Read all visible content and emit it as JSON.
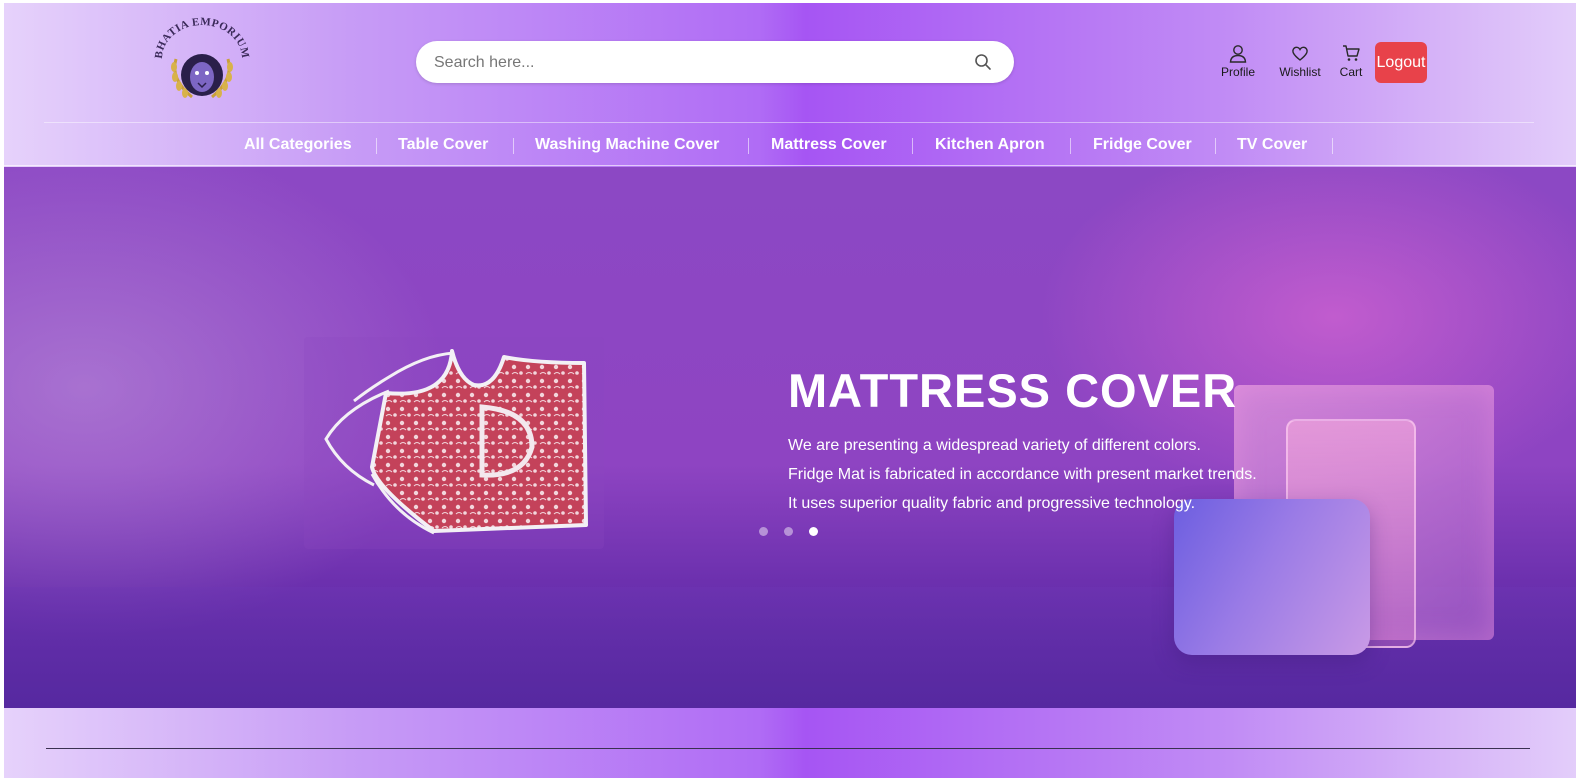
{
  "brand": {
    "logo_text": "BHATIA EMPORIUM"
  },
  "search": {
    "placeholder": "Search here...",
    "icon": "search-icon"
  },
  "user_links": [
    {
      "label": "Profile",
      "icon": "user-icon"
    },
    {
      "label": "Wishlist",
      "icon": "heart-icon"
    },
    {
      "label": "Cart",
      "icon": "cart-icon"
    }
  ],
  "logout_label": "Logout",
  "nav": {
    "items": [
      {
        "label": "All Categories"
      },
      {
        "label": "Table Cover"
      },
      {
        "label": "Washing Machine Cover"
      },
      {
        "label": "Mattress Cover"
      },
      {
        "label": "Kitchen Apron"
      },
      {
        "label": "Fridge Cover"
      },
      {
        "label": "TV Cover"
      }
    ]
  },
  "hero": {
    "title": "MATTRESS COVER",
    "lines": [
      "We are presenting a widespread variety of different colors.",
      "Fridge Mat is fabricated in accordance with present market trends.",
      "It uses superior quality fabric and progressive technology."
    ],
    "slide_count": 3,
    "active_slide": 3
  },
  "colors": {
    "logout": "#e8424a",
    "hero_purple": "#8e44c2",
    "accent_pink": "#ec6ed7"
  }
}
